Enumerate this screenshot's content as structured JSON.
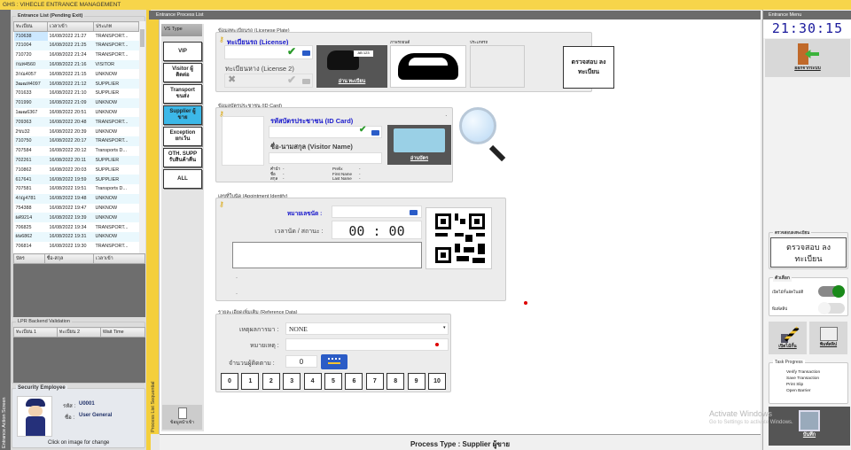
{
  "app": {
    "title": "GHS : VIHECLE ENTRANCE MANAGEMENT",
    "left_strip": "Entrance Action Screen",
    "process_strip": "Process List Sequential"
  },
  "entrance_list": {
    "title": "Entrance List (Pending Exit)",
    "columns": [
      "ทะเบียน",
      "เวลาเข้า",
      "ประเภท"
    ],
    "rows": [
      [
        "710638",
        "16/08/2022 21:27",
        "TRANSPORT..."
      ],
      [
        "721004",
        "16/08/2022 21:25",
        "TRANSPORT..."
      ],
      [
        "710720",
        "16/08/2022 21:24",
        "TRANSPORT..."
      ],
      [
        "กนท4560",
        "16/08/2022 21:16",
        "VISITOR"
      ],
      [
        "3กณ4057",
        "16/08/2022 21:15",
        "UNKNOW"
      ],
      [
        "3ฒฒท4097",
        "16/08/2022 21:12",
        "SUPPLIER"
      ],
      [
        "701633",
        "16/08/2022 21:10",
        "SUPPLIER"
      ],
      [
        "701990",
        "16/08/2022 21:09",
        "UNKNOW"
      ],
      [
        "1ฒฒ6367",
        "16/08/2022 20:51",
        "UNKNOW"
      ],
      [
        "709363",
        "16/08/2022 20:48",
        "TRANSPORT..."
      ],
      [
        "2ขบ32",
        "16/08/2022 20:39",
        "UNKNOW"
      ],
      [
        "710750",
        "16/08/2022 20:17",
        "TRANSPORT..."
      ],
      [
        "707584",
        "16/08/2022 20:12",
        "Transports D..."
      ],
      [
        "702261",
        "16/08/2022 20:11",
        "SUPPLIER"
      ],
      [
        "710862",
        "16/08/2022 20:03",
        "SUPPLIER"
      ],
      [
        "617641",
        "16/08/2022 19:59",
        "SUPPLIER"
      ],
      [
        "707581",
        "16/08/2022 19:51",
        "Transports D..."
      ],
      [
        "4กญ4781",
        "16/08/2022 19:48",
        "UNKNOW"
      ],
      [
        "754388",
        "16/08/2022 19:47",
        "UNKNOW"
      ],
      [
        "ผศ9214",
        "16/08/2022 19:39",
        "UNKNOW"
      ],
      [
        "706825",
        "16/08/2022 19:34",
        "TRANSPORT..."
      ],
      [
        "ผษ6862",
        "16/08/2022 19:31",
        "UNKNOW"
      ],
      [
        "706814",
        "16/08/2022 19:30",
        "TRANSPORT..."
      ]
    ]
  },
  "visitor_list": {
    "columns": [
      "บัตร",
      "ชื่อ-สกุล",
      "เวลาเข้า"
    ]
  },
  "lpr": {
    "title": "LPR Backend Validation",
    "columns": [
      "ทะเบียน 1",
      "ทะเบียน 2",
      "Wait Time"
    ]
  },
  "security": {
    "title": "Security Employee",
    "id_label": "รหัส :",
    "id": "U0001",
    "name_label": "ชื่อ :",
    "name": "User General",
    "hint": "Click on image for change"
  },
  "center": {
    "header": "Entrance Process List",
    "vs_type": "VS Type",
    "vs_buttons": [
      "VIP",
      "Visitor ผู้ติดต่อ",
      "Transport ขนส่ง",
      "Supplier ผู้ขาย",
      "Exception ยกเว้น",
      "OTH. SUPP รับสินค้าคืน",
      "ALL"
    ],
    "vs_selected": 3,
    "plate": {
      "title": "ข้อมูลทะเบียนรถ (Licenese Plate)",
      "license_label": "ทะเบียนรถ (License)",
      "license2_label": "ทะเบียนหาง (License 2)",
      "license_value": "",
      "license2_value": "",
      "read_button": "อ่าน ทะเบียน",
      "car_label": "ภาพรถยนต์",
      "extra_label": "ประเภทรถ",
      "verify_button": "ตรวจสอบ ลงทะเบียน",
      "plate_sample": "AB 123"
    },
    "idcard": {
      "title": "ข้อมูลบัตรประชาชน (ID Card)",
      "id_label": "รหัสบัตรประชาชน (ID Card)",
      "name_label": "ชื่อ-นามสกุล (Visitor Name)",
      "read_button": "อ่านบัตร",
      "fields": [
        [
          "คำนำ",
          "-"
        ],
        [
          "ชื่อ",
          "-"
        ],
        [
          "สกุล",
          "-"
        ]
      ],
      "fields_en": [
        [
          "Prefix",
          "-"
        ],
        [
          "First Name",
          "-"
        ],
        [
          "Last Name",
          "-"
        ]
      ],
      "dot": "."
    },
    "appointment": {
      "title": "เลขที่ใบนัด (Apointment Identify)",
      "number_label": "หมายเลขนัด :",
      "time_label": "เวลานัด / สถานะ :",
      "time": "00 : 00",
      "line1": "-",
      "line2": "-"
    },
    "reference": {
      "title": "รายละเอียดเพิ่มเติม (Reference Data)",
      "reason_label": "เหตุผลการมา :",
      "reason": "NONE",
      "note_label": "หมายเหตุ :",
      "followers_label": "จำนวนผู้ติดตาม :",
      "followers": "0",
      "numbers": [
        "0",
        "1",
        "2",
        "3",
        "4",
        "5",
        "6",
        "7",
        "8",
        "9",
        "10"
      ]
    },
    "doc_button": "ข้อมูลนำเข้า"
  },
  "right": {
    "header": "Entrance Menu",
    "clock": "21:30:15",
    "logout": "ออกจากระบบ",
    "verify_title": "ตรวจสอบลงทะเบียน",
    "verify_button": "ตรวจสอบ ลงทะเบียน",
    "options_title": "ตัวเลือก",
    "option1": "เปิดไม้กั้นอัตโนมัติ",
    "option1_on": true,
    "option2": "พิมพ์สลิป",
    "option2_on": false,
    "open_barrier": "เปิดไม้กั้น",
    "print_slip": "พิมพ์สลิป",
    "task_title": "Task Progress",
    "tasks": [
      "Verify Transaction",
      "Save Transaction",
      "Print Slip",
      "Open Barrier"
    ],
    "save": "บันทึก"
  },
  "status": "Process Type : Supplier ผู้ขาย",
  "watermark": {
    "line1": "Activate Windows",
    "line2": "Go to Settings to activate Windows."
  }
}
